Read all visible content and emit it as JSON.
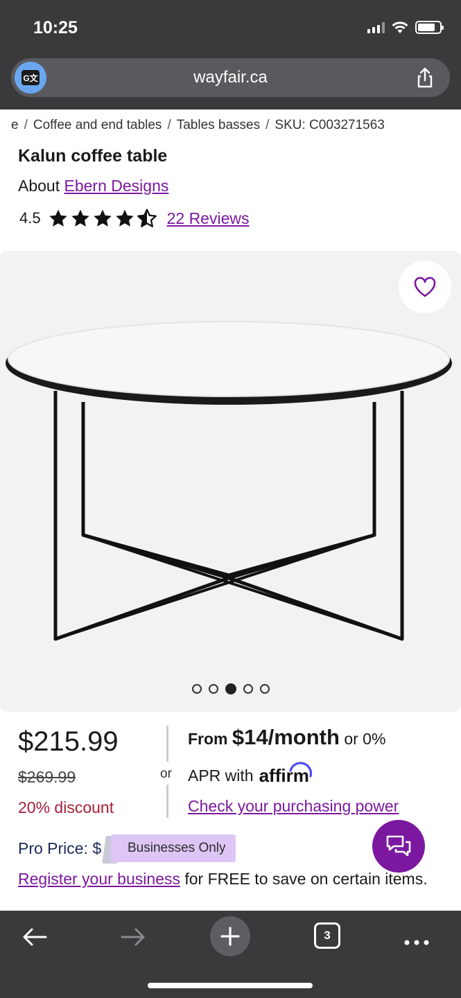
{
  "status_bar": {
    "time": "10:25"
  },
  "browser": {
    "url": "wayfair.ca",
    "translate_icon": "translate-icon",
    "translate_label": "G文",
    "share_icon": "share-icon"
  },
  "breadcrumb": {
    "items": [
      "e",
      "Coffee and end tables",
      "Tables basses",
      "SKU: C003271563"
    ],
    "separator": "/"
  },
  "product": {
    "title": "Kalun coffee table",
    "about_prefix": "About",
    "brand": "Ebern Designs",
    "rating": "4.5",
    "stars": 4.5,
    "reviews": "22 Reviews"
  },
  "gallery": {
    "favorite_icon": "heart-icon",
    "dot_count": 5,
    "active_dot": 3
  },
  "pricing": {
    "price": "$215.99",
    "old_price": "$269.99",
    "discount": "20% discount",
    "or": "or",
    "from_prefix": "From",
    "monthly": "$14/month",
    "from_suffix": "or 0%",
    "apr_text": "APR with",
    "affirm": "affirm",
    "check_power": "Check your purchasing power"
  },
  "pro": {
    "label": "Pro Price: $",
    "badge": "Businesses Only",
    "register_link": "Register your business",
    "register_text": " for FREE to save on certain items."
  },
  "colors": {
    "accent_purple": "#7b189f",
    "discount_red": "#a51d38",
    "chrome": "#3a3a3c",
    "badge": "#ddc6f5"
  },
  "toolbar": {
    "back_icon": "back-arrow-icon",
    "forward_icon": "forward-arrow-icon",
    "new_tab_icon": "plus-icon",
    "tab_count": "3",
    "more_icon": "more-icon"
  }
}
